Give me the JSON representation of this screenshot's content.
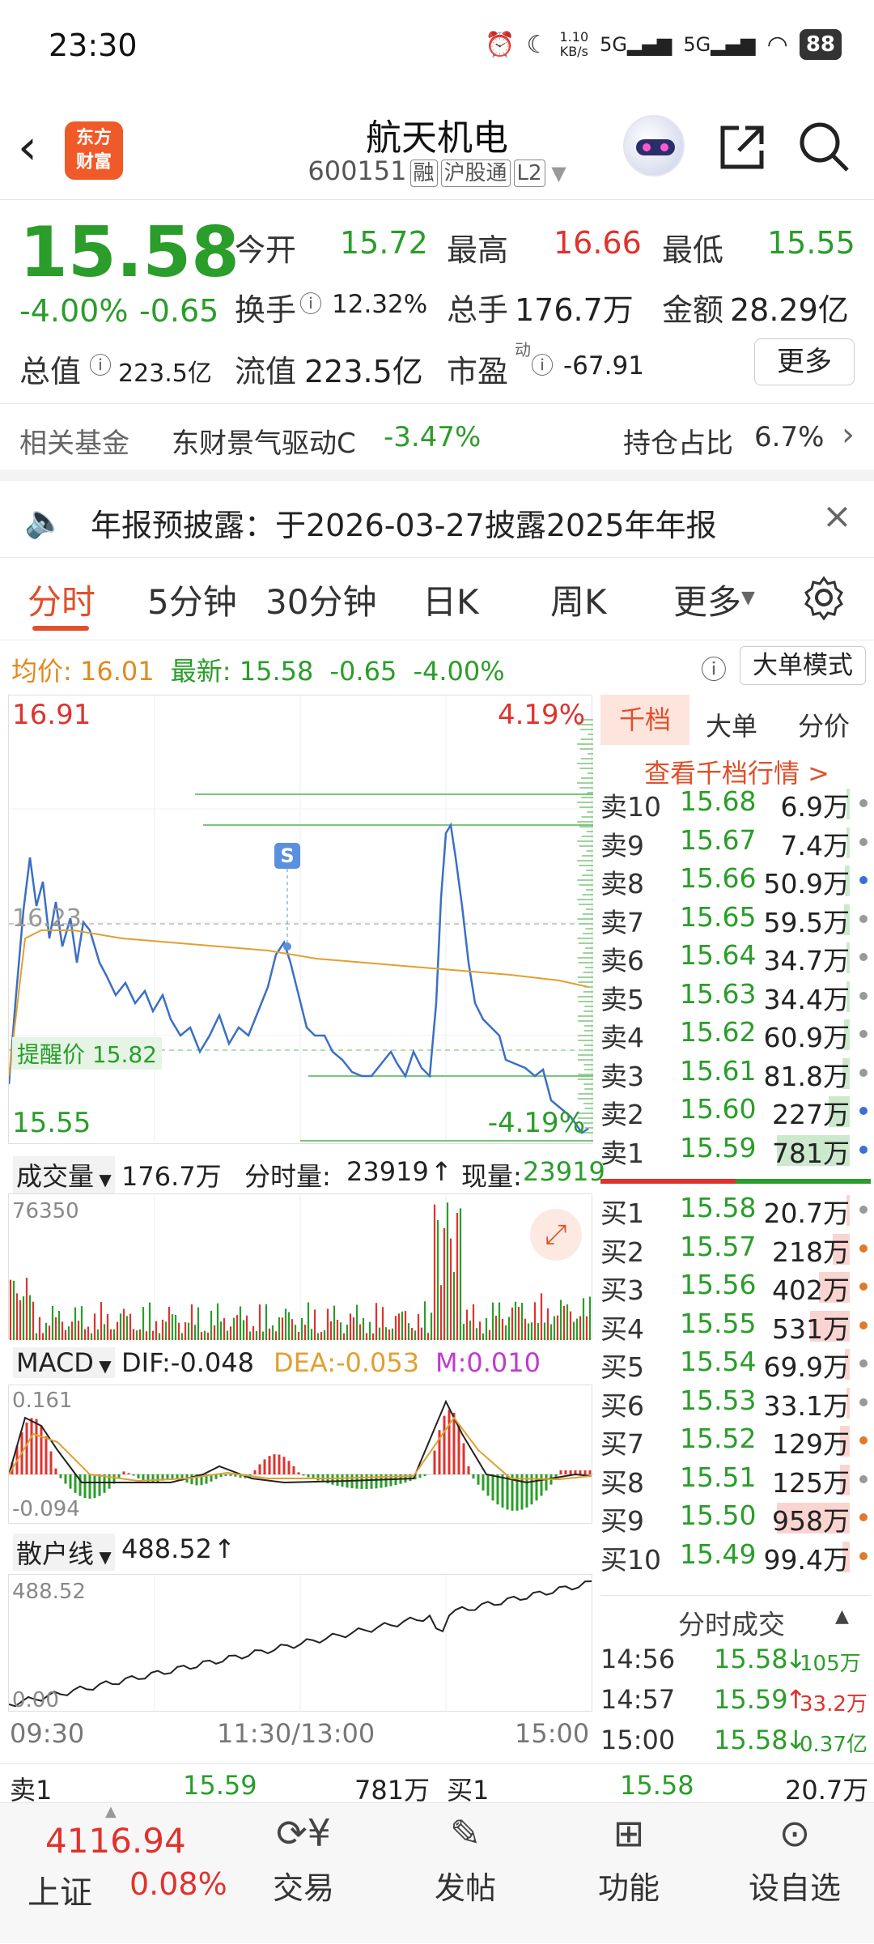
{
  "status": {
    "time": "23:30",
    "net": "1.10\nKB/s",
    "battery": "88"
  },
  "header": {
    "logo": "东方\n财富",
    "name": "航天机电",
    "code": "600151",
    "tags": [
      "融",
      "沪股通",
      "L2"
    ]
  },
  "quote": {
    "price": "15.58",
    "pct": "-4.00%",
    "chg": "-0.65",
    "open_l": "今开",
    "open": "15.72",
    "high_l": "最高",
    "high": "16.66",
    "low_l": "最低",
    "low": "15.55",
    "turn_l": "换手",
    "turn": "12.32%",
    "vol_l": "总手",
    "vol": "176.7万",
    "amt_l": "金额",
    "amt": "28.29亿",
    "cap_l": "总值",
    "cap": "223.5亿",
    "fcap_l": "流值",
    "fcap": "223.5亿",
    "pe_l": "市盈",
    "pe_sup": "动",
    "pe": "-67.91",
    "more": "更多"
  },
  "fund": {
    "label": "相关基金",
    "name": "东财景气驱动C",
    "pct": "-3.47%",
    "hold_l": "持仓占比",
    "hold": "6.7%"
  },
  "notice": {
    "text": "年报预披露：于2026-03-27披露2025年年报"
  },
  "tabs": [
    "分时",
    "5分钟",
    "30分钟",
    "日K",
    "周K",
    "更多"
  ],
  "infoline": {
    "avg_l": "均价:",
    "avg": "16.01",
    "last_l": "最新:",
    "last": "15.58",
    "chg": "-0.65",
    "pct": "-4.00%",
    "mode": "大单模式"
  },
  "chart_main": {
    "high": "16.91",
    "low": "15.55",
    "up_pct": "4.19%",
    "dn_pct": "-4.19%",
    "mid": "16.23",
    "alert": "提醒价 15.82",
    "s_mark": "S"
  },
  "side_tabs": [
    "千档",
    "大单",
    "分价"
  ],
  "side_link": "查看千档行情 >",
  "asks": [
    {
      "l": "卖10",
      "p": "15.68",
      "v": "6.9万",
      "w": 0.01,
      "d": "#999"
    },
    {
      "l": "卖9",
      "p": "15.67",
      "v": "7.4万",
      "w": 0.01,
      "d": "#999"
    },
    {
      "l": "卖8",
      "p": "15.66",
      "v": "50.9万",
      "w": 0.07,
      "d": "#3b6fd6"
    },
    {
      "l": "卖7",
      "p": "15.65",
      "v": "59.5万",
      "w": 0.08,
      "d": "#999"
    },
    {
      "l": "卖6",
      "p": "15.64",
      "v": "34.7万",
      "w": 0.05,
      "d": "#999"
    },
    {
      "l": "卖5",
      "p": "15.63",
      "v": "34.4万",
      "w": 0.05,
      "d": "#999"
    },
    {
      "l": "卖4",
      "p": "15.62",
      "v": "60.9万",
      "w": 0.08,
      "d": "#999"
    },
    {
      "l": "卖3",
      "p": "15.61",
      "v": "81.8万",
      "w": 0.1,
      "d": "#999"
    },
    {
      "l": "卖2",
      "p": "15.60",
      "v": "227万",
      "w": 0.29,
      "d": "#3b6fd6"
    },
    {
      "l": "卖1",
      "p": "15.59",
      "v": "781万",
      "w": 1.0,
      "d": "#3b6fd6"
    }
  ],
  "bids": [
    {
      "l": "买1",
      "p": "15.58",
      "v": "20.7万",
      "w": 0.03,
      "d": "#999"
    },
    {
      "l": "买2",
      "p": "15.57",
      "v": "218万",
      "w": 0.23,
      "d": "#e07a2a"
    },
    {
      "l": "买3",
      "p": "15.56",
      "v": "402万",
      "w": 0.42,
      "d": "#e07a2a"
    },
    {
      "l": "买4",
      "p": "15.55",
      "v": "531万",
      "w": 0.55,
      "d": "#e07a2a"
    },
    {
      "l": "买5",
      "p": "15.54",
      "v": "69.9万",
      "w": 0.07,
      "d": "#999"
    },
    {
      "l": "买6",
      "p": "15.53",
      "v": "33.1万",
      "w": 0.04,
      "d": "#999"
    },
    {
      "l": "买7",
      "p": "15.52",
      "v": "129万",
      "w": 0.13,
      "d": "#e07a2a"
    },
    {
      "l": "买8",
      "p": "15.51",
      "v": "125万",
      "w": 0.13,
      "d": "#999"
    },
    {
      "l": "买9",
      "p": "15.50",
      "v": "958万",
      "w": 1.0,
      "d": "#e07a2a"
    },
    {
      "l": "买10",
      "p": "15.49",
      "v": "99.4万",
      "w": 0.1,
      "d": "#e07a2a"
    }
  ],
  "ticks_title": "分时成交",
  "ticks": [
    {
      "t": "14:56",
      "p": "15.58",
      "arrow": "↓",
      "v": "105万",
      "c": "#2a9d2a"
    },
    {
      "t": "14:57",
      "p": "15.59",
      "arrow": "↑",
      "v": "33.2万",
      "c": "#e0322d"
    },
    {
      "t": "15:00",
      "p": "15.58",
      "arrow": "↓",
      "v": "0.37亿",
      "c": "#2a9d2a"
    }
  ],
  "volume": {
    "label": "成交量",
    "total": "176.7万",
    "tick_l": "分时量:",
    "tick": "23919",
    "now_l": "现量:",
    "now": "23919",
    "max": "76350"
  },
  "macd": {
    "label": "MACD",
    "dif": "DIF:-0.048",
    "dea": "DEA:-0.053",
    "m": "M:0.010",
    "top": "0.161",
    "bot": "-0.094"
  },
  "sanhu": {
    "label": "散户线",
    "val": "488.52",
    "top": "488.52",
    "bot": "0.00"
  },
  "xaxis": [
    "09:30",
    "11:30/13:00",
    "15:00"
  ],
  "bottom_quote": {
    "s_l": "卖1",
    "s_p": "15.59",
    "s_v": "781万",
    "b_l": "买1",
    "b_p": "15.58",
    "b_v": "20.7万"
  },
  "footer": {
    "index_val": "4116.94",
    "index_name": "上证",
    "index_pct": "0.08%",
    "items": [
      "交易",
      "发帖",
      "功能",
      "设自选"
    ]
  }
}
